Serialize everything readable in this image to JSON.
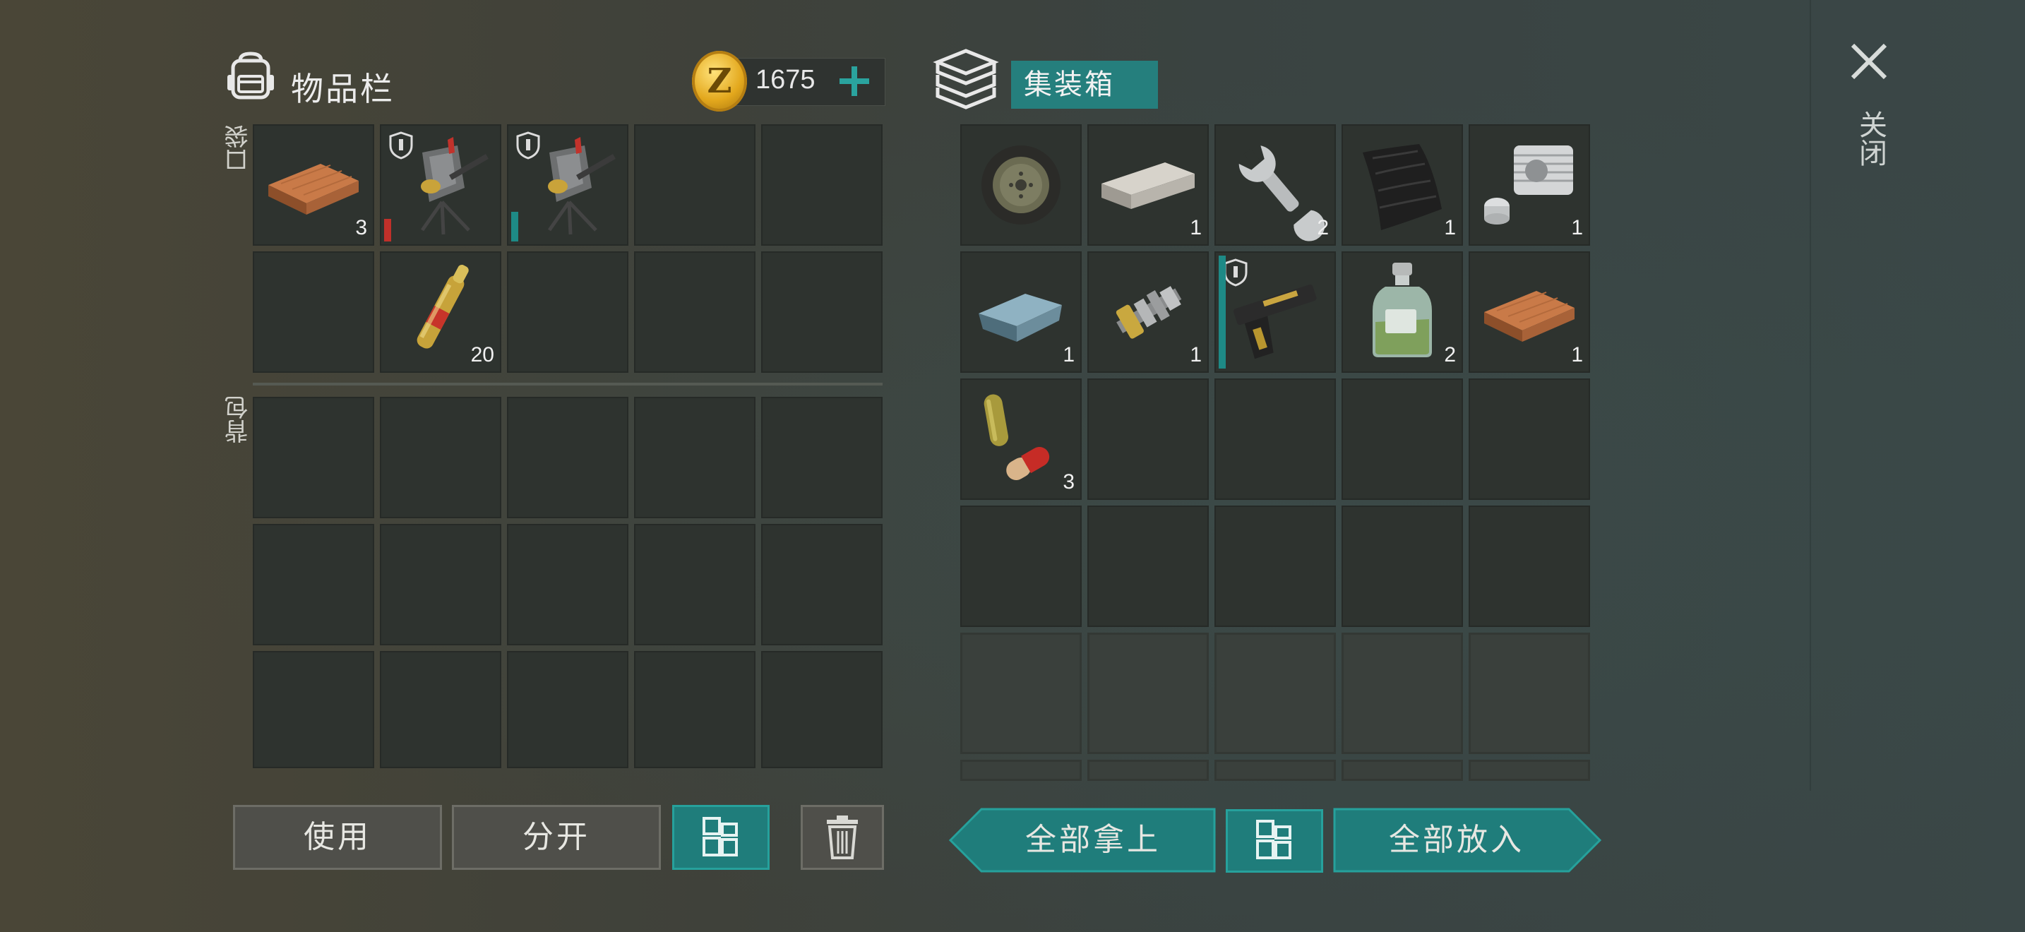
{
  "inventory": {
    "title": "物品栏",
    "gold": "1675",
    "pocket_label": "口袋",
    "backpack_label": "背包",
    "pocket_rows": [
      [
        {
          "icon": "wood-plank-icon",
          "qty": "3"
        },
        {
          "icon": "mounted-turret-icon",
          "qty": "",
          "durability": "red",
          "shield": true
        },
        {
          "icon": "mounted-turret-icon",
          "qty": "",
          "durability": "teal",
          "shield": true
        },
        {
          "icon": "",
          "qty": ""
        },
        {
          "icon": "",
          "qty": ""
        }
      ],
      [
        {
          "icon": "",
          "qty": ""
        },
        {
          "icon": "ampoule-icon",
          "qty": "20"
        },
        {
          "icon": "",
          "qty": ""
        },
        {
          "icon": "",
          "qty": ""
        },
        {
          "icon": "",
          "qty": ""
        }
      ]
    ],
    "backpack_rows": 3,
    "buttons": {
      "use": "使用",
      "split": "分开"
    }
  },
  "container": {
    "title": "集装箱",
    "rows": [
      [
        {
          "icon": "wheel-icon",
          "qty": ""
        },
        {
          "icon": "metal-bar-icon",
          "qty": "1"
        },
        {
          "icon": "wrench-icon",
          "qty": "2"
        },
        {
          "icon": "fabric-sheet-icon",
          "qty": "1"
        },
        {
          "icon": "engine-cylinder-icon",
          "qty": "1"
        }
      ],
      [
        {
          "icon": "steel-ingot-icon",
          "qty": "1"
        },
        {
          "icon": "gear-shaft-icon",
          "qty": "1"
        },
        {
          "icon": "pistol-icon",
          "qty": "",
          "durability": "teal",
          "shield": true
        },
        {
          "icon": "acid-bottle-icon",
          "qty": "2"
        },
        {
          "icon": "wood-plank-icon",
          "qty": "1"
        }
      ],
      [
        {
          "icon": "pills-icon",
          "qty": "3"
        },
        {
          "icon": "",
          "qty": ""
        },
        {
          "icon": "",
          "qty": ""
        },
        {
          "icon": "",
          "qty": ""
        },
        {
          "icon": "",
          "qty": ""
        }
      ]
    ],
    "buttons": {
      "take_all": "全部拿上",
      "put_all": "全部放入"
    }
  },
  "close_label": "关闭",
  "colors": {
    "teal": "#1f7d7b",
    "teal_border": "#26a19c",
    "slot": "#2e332f",
    "durability_red": "#c0302a",
    "durability_teal": "#1e8a86"
  }
}
